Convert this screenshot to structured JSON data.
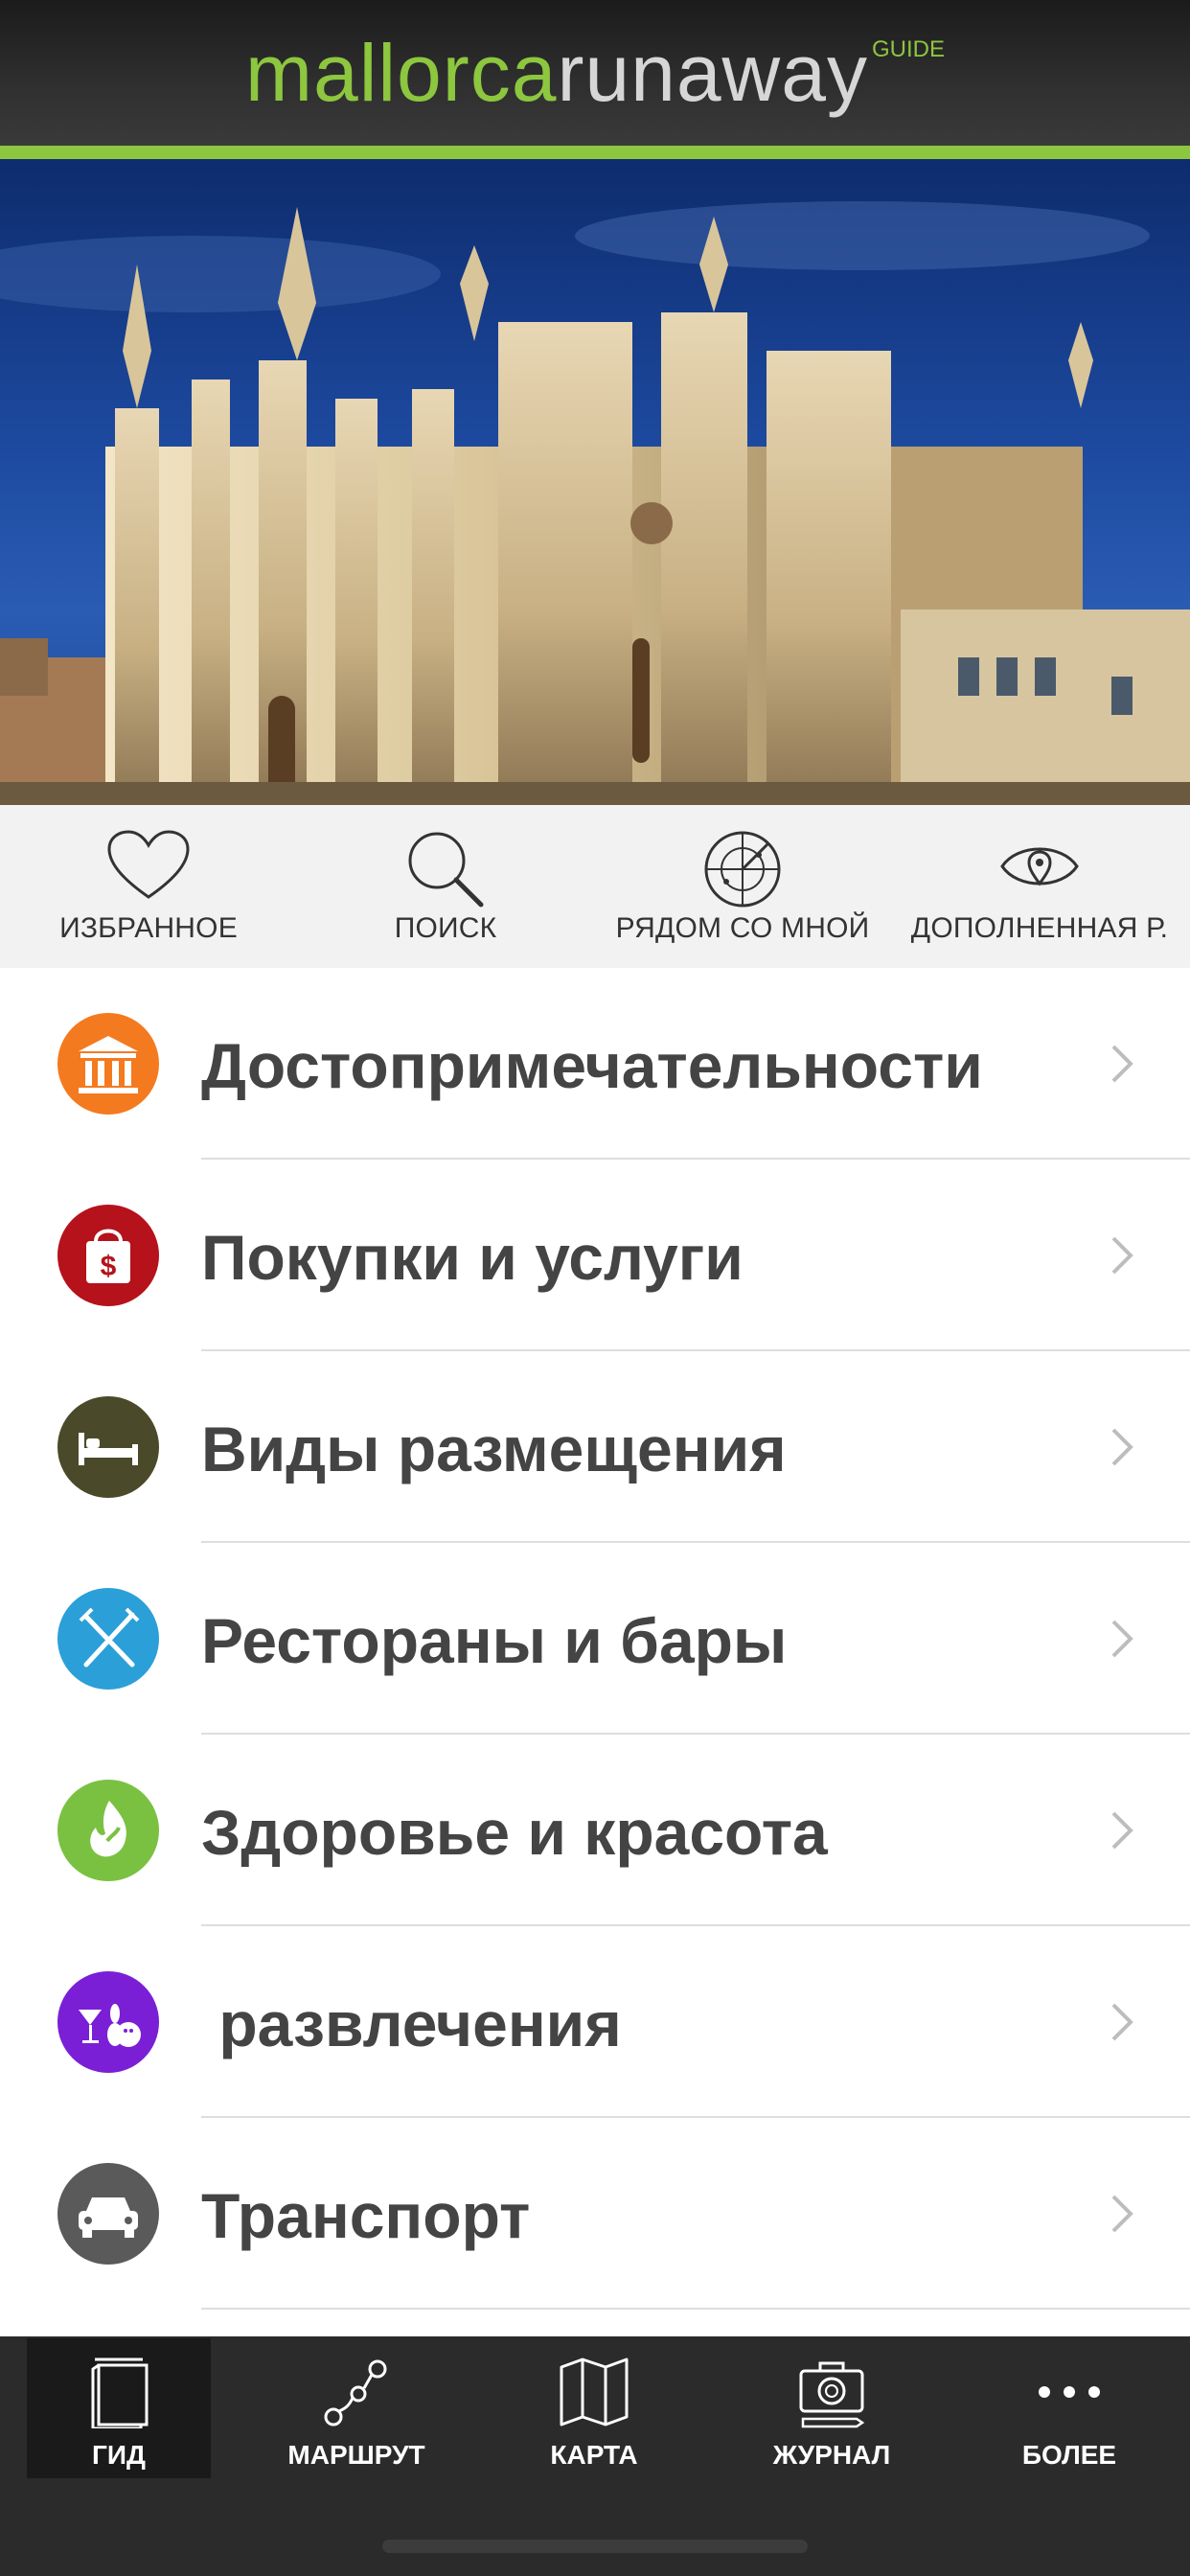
{
  "header": {
    "logo_part1": "mallorca",
    "logo_part2": "runaway",
    "logo_sup": "GUIDE",
    "accent_color": "#8dc63f"
  },
  "quick_actions": [
    {
      "label": "ИЗБРАННОЕ",
      "icon": "heart-icon"
    },
    {
      "label": "ПОИСК",
      "icon": "search-icon"
    },
    {
      "label": "РЯДОМ СО МНОЙ",
      "icon": "radar-icon"
    },
    {
      "label": "ДОПОЛНЕННАЯ Р.",
      "icon": "eye-location-icon"
    }
  ],
  "categories": [
    {
      "label": "Достопримечательности",
      "icon": "landmark-icon",
      "color": "#f47a20"
    },
    {
      "label": "Покупки и услуги",
      "icon": "shopping-bag-icon",
      "color": "#b5121b"
    },
    {
      "label": "Виды размещения",
      "icon": "bed-icon",
      "color": "#4a4a2a"
    },
    {
      "label": "Рестораны и бары",
      "icon": "fork-knife-icon",
      "color": "#2b9fd8"
    },
    {
      "label": "Здоровье и красота",
      "icon": "flame-leaf-icon",
      "color": "#7ac142"
    },
    {
      "label": " развлечения",
      "icon": "bowling-cocktail-icon",
      "color": "#7a1fd6"
    },
    {
      "label": "Транспорт",
      "icon": "car-icon",
      "color": "#5a5a5a"
    }
  ],
  "tabs": [
    {
      "label": "ГИД",
      "icon": "guide-book-icon",
      "active": true
    },
    {
      "label": "МАРШРУТ",
      "icon": "route-icon",
      "active": false
    },
    {
      "label": "КАРТА",
      "icon": "map-icon",
      "active": false
    },
    {
      "label": "ЖУРНАЛ",
      "icon": "camera-journal-icon",
      "active": false
    },
    {
      "label": "БОЛЕЕ",
      "icon": "more-dots-icon",
      "active": false
    }
  ]
}
